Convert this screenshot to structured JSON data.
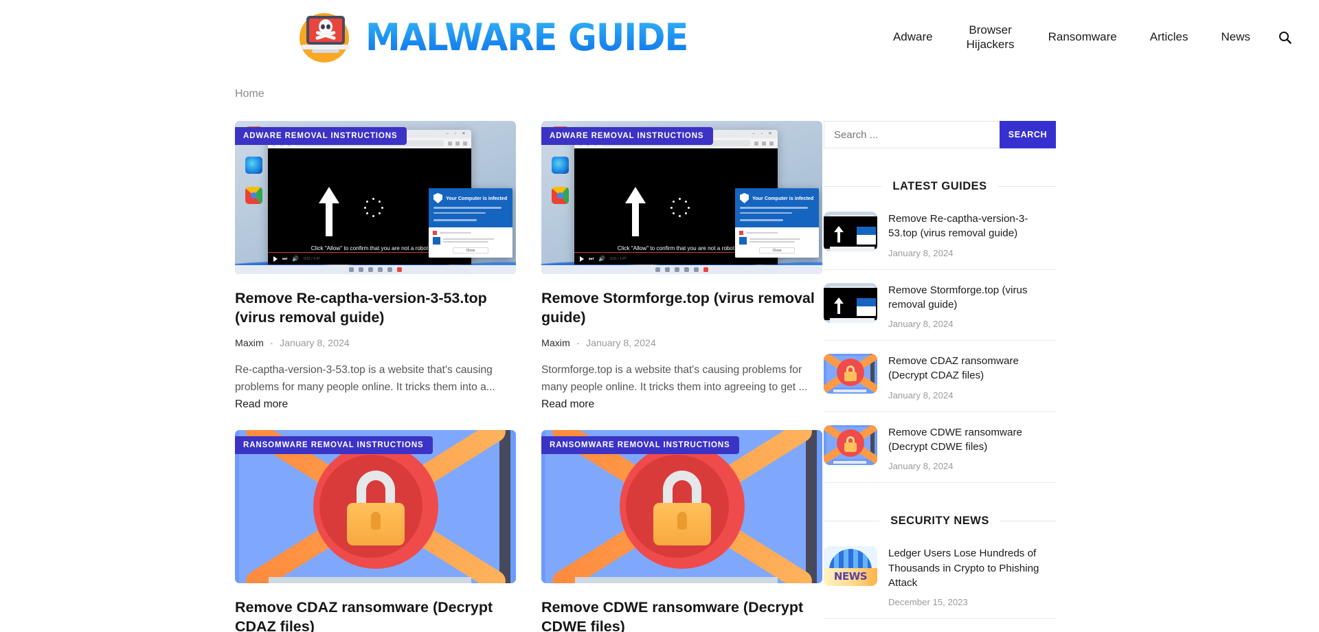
{
  "header": {
    "logo_icon": "laptop-skull-icon",
    "logo_text": "MALWARE GUIDE",
    "nav": [
      {
        "label": "Adware"
      },
      {
        "label": "Browser Hijackers"
      },
      {
        "label": "Ransomware"
      },
      {
        "label": "Articles"
      },
      {
        "label": "News"
      }
    ],
    "search_icon": "search-icon"
  },
  "breadcrumb": {
    "home": "Home"
  },
  "main": {
    "cards": [
      {
        "badge": "ADWARE REMOVAL INSTRUCTIONS",
        "thumb_type": "adware",
        "thumb_alert_title": "Your Computer is infected",
        "thumb_allow_text": "Click \"Allow\" to confirm that you are not a robot",
        "thumb_close_label": "Close",
        "title": "Remove Re-captha-version-3-53.top (virus removal guide)",
        "author": "Maxim",
        "date": "January 8, 2024",
        "excerpt": "Re-captha-version-3-53.top is a website that's causing problems for many people online. It tricks them into a...",
        "read_more": "Read more"
      },
      {
        "badge": "ADWARE REMOVAL INSTRUCTIONS",
        "thumb_type": "adware",
        "thumb_alert_title": "Your Computer is infected",
        "thumb_allow_text": "Click \"Allow\" to confirm that you are not a robot",
        "thumb_close_label": "Close",
        "title": "Remove Stormforge.top (virus removal guide)",
        "author": "Maxim",
        "date": "January 8, 2024",
        "excerpt": "Stormforge.top is a website that's causing problems for many people online. It tricks them into agreeing to get ...",
        "read_more": "Read more"
      },
      {
        "badge": "RANSOMWARE REMOVAL INSTRUCTIONS",
        "thumb_type": "ransomware",
        "title": "Remove CDAZ ransomware (Decrypt CDAZ files)",
        "author": "",
        "date": "",
        "excerpt": "",
        "read_more": ""
      },
      {
        "badge": "RANSOMWARE REMOVAL INSTRUCTIONS",
        "thumb_type": "ransomware",
        "title": "Remove CDWE ransomware (Decrypt CDWE files)",
        "author": "",
        "date": "",
        "excerpt": "",
        "read_more": ""
      }
    ]
  },
  "sidebar": {
    "search": {
      "placeholder": "Search ...",
      "value": "",
      "button_label": "SEARCH"
    },
    "latest_guides": {
      "heading": "LATEST GUIDES",
      "items": [
        {
          "thumb_type": "adware",
          "title": "Remove Re-captha-version-3-53.top (virus removal guide)",
          "date": "January 8, 2024"
        },
        {
          "thumb_type": "adware",
          "title": "Remove Stormforge.top (virus removal guide)",
          "date": "January 8, 2024"
        },
        {
          "thumb_type": "ransomware",
          "title": "Remove CDAZ ransomware (Decrypt CDAZ files)",
          "date": "January 8, 2024"
        },
        {
          "thumb_type": "ransomware",
          "title": "Remove CDWE ransomware (Decrypt CDWE files)",
          "date": "January 8, 2024"
        }
      ]
    },
    "security_news": {
      "heading": "SECURITY NEWS",
      "items": [
        {
          "thumb_type": "news",
          "thumb_label": "NEWS",
          "title": "Ledger Users Lose Hundreds of Thousands in Crypto to Phishing Attack",
          "date": "December 15, 2023"
        }
      ]
    }
  },
  "colors": {
    "badge": "#3b33c6",
    "search_button": "#3730d0",
    "logo_blue": "#1d8ef0",
    "muted_text": "#9a9a9a"
  }
}
